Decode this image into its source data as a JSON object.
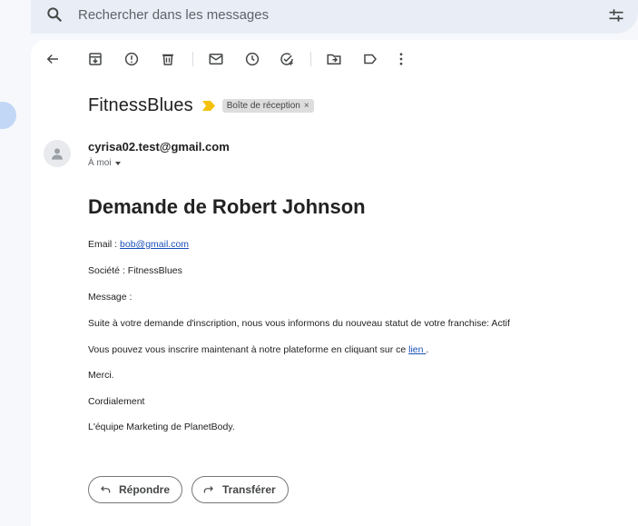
{
  "search": {
    "placeholder": "Rechercher dans les messages"
  },
  "toolbar": {
    "icons": [
      "back-arrow-icon",
      "archive-icon",
      "report-spam-icon",
      "delete-icon",
      "mark-unread-icon",
      "snooze-icon",
      "add-task-icon",
      "move-to-icon",
      "label-icon",
      "more-vert-icon"
    ]
  },
  "email": {
    "subject": "FitnessBlues",
    "label_chip": "Boîte de réception",
    "label_close": "×",
    "sender": "cyrisa02.test@gmail.com",
    "to": "À moi",
    "heading": "Demande de Robert Johnson",
    "email_prefix": "Email : ",
    "email_link": "bob@gmail.com",
    "company": "Société : FitnessBlues",
    "message_label": "Message :",
    "line1": "Suite à votre demande d'inscription, nous vous informons du nouveau statut de votre franchise: Actif",
    "line2_prefix": "Vous pouvez vous inscrire maintenant à notre plateforme en cliquant sur ce ",
    "line2_link": "lien ",
    "line2_suffix": ".",
    "thanks": "Merci.",
    "regards": "Cordialement",
    "signature": "L'équipe Marketing de PlanetBody."
  },
  "actions": {
    "reply": "Répondre",
    "forward": "Transférer"
  },
  "colors": {
    "link": "#1a4fb8",
    "importance": "#f4c20d",
    "background": "#f6f8fc"
  }
}
